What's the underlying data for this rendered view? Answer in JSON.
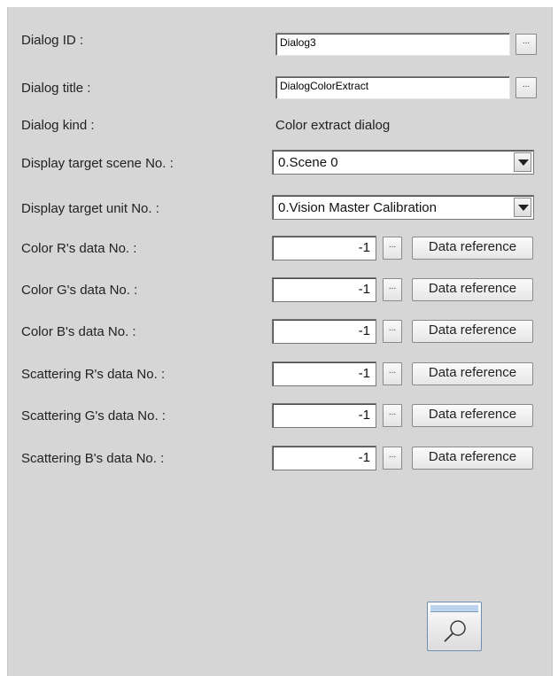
{
  "dialog_id": {
    "label": "Dialog ID :",
    "value": "Dialog3",
    "browse": "..."
  },
  "dialog_title": {
    "label": "Dialog title :",
    "value": "DialogColorExtract",
    "browse": "..."
  },
  "dialog_kind": {
    "label": "Dialog kind :",
    "value": "Color extract dialog"
  },
  "scene": {
    "label": "Display target scene No. :",
    "selected": "0.Scene 0"
  },
  "unit": {
    "label": "Display target unit No. :",
    "selected": "0.Vision Master Calibration"
  },
  "data_rows": [
    {
      "label": "Color R's data No. :",
      "value": "-1",
      "browse": "...",
      "button": "Data reference"
    },
    {
      "label": "Color G's data No. :",
      "value": "-1",
      "browse": "...",
      "button": "Data reference"
    },
    {
      "label": "Color B's data No. :",
      "value": "-1",
      "browse": "...",
      "button": "Data reference"
    },
    {
      "label": "Scattering R's data No. :",
      "value": "-1",
      "browse": "...",
      "button": "Data reference"
    },
    {
      "label": "Scattering G's data No. :",
      "value": "-1",
      "browse": "...",
      "button": "Data reference"
    },
    {
      "label": "Scattering B's data No. :",
      "value": "-1",
      "browse": "...",
      "button": "Data reference"
    }
  ],
  "preview_icon": "magnifier-window-icon"
}
